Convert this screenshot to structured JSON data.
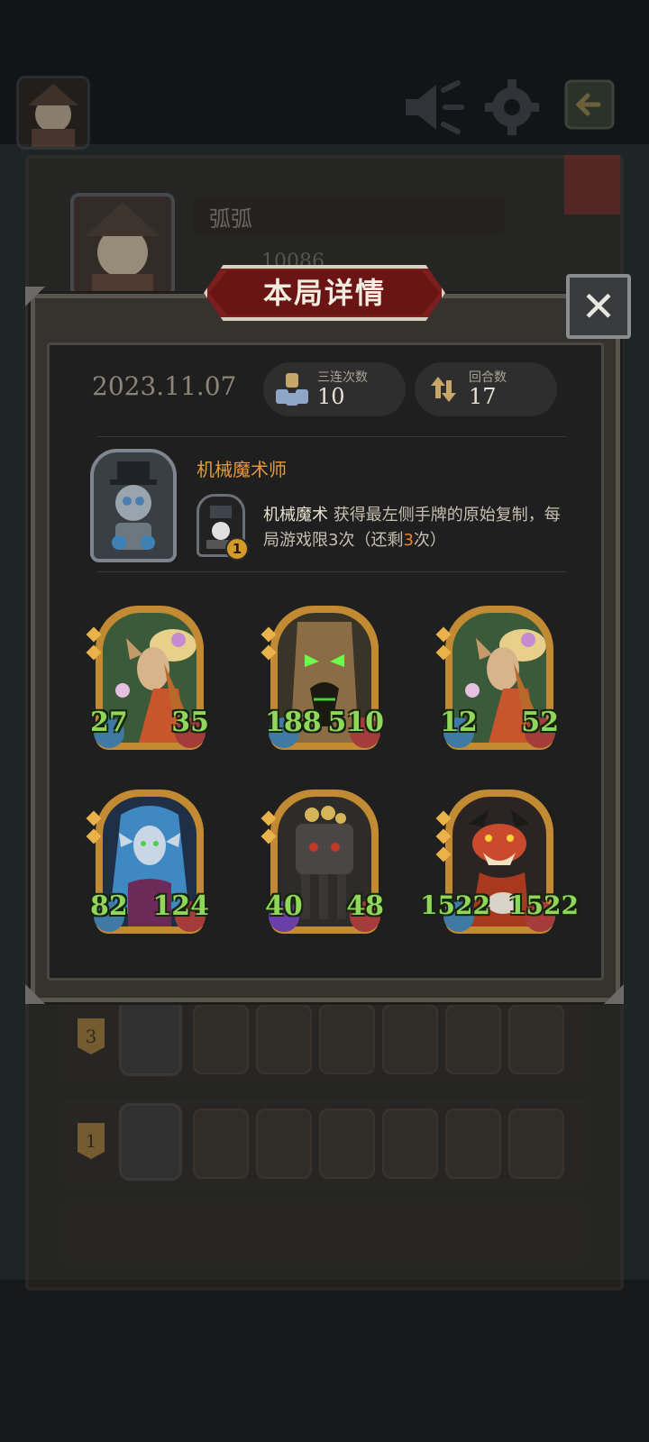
{
  "profile": {
    "name": "弧弧",
    "score": "10086"
  },
  "dialog": {
    "title": "本局详情",
    "close_symbol": "✕"
  },
  "summary": {
    "date": "2023.11.07",
    "triples_label": "三连次数",
    "triples_value": "10",
    "rounds_label": "回合数",
    "rounds_value": "17"
  },
  "hero": {
    "name": "机械魔术师",
    "skill_level": "1",
    "skill_name": "机械魔术",
    "skill_text_1": " 获得最左侧手牌的原始复制，每局游戏限3次（还剩",
    "skill_remaining": "3",
    "skill_text_2": "次）"
  },
  "cards": [
    {
      "name": "flower-elf-card",
      "atk": "27",
      "hp": "35"
    },
    {
      "name": "treant-card",
      "atk": "188",
      "hp": "510"
    },
    {
      "name": "flower-elf-card",
      "atk": "12",
      "hp": "52"
    },
    {
      "name": "siren-card",
      "atk": "82",
      "hp": "124"
    },
    {
      "name": "stone-golem-card",
      "atk": "40",
      "hp": "48"
    },
    {
      "name": "red-dragon-card",
      "atk": "1522",
      "hp": "1522"
    }
  ],
  "history": [
    {
      "rank": "3"
    },
    {
      "rank": "1"
    }
  ],
  "icons": {
    "top_left": "player-avatar-icon",
    "top_speaker": "speaker-icon",
    "top_settings": "gear-icon",
    "top_exit": "exit-icon",
    "triples": "triple-merge-icon",
    "rounds": "round-cycle-icon"
  },
  "colors": {
    "title_red": "#7a1e1e",
    "hero_name": "#e59a3b",
    "stat_green": "#8fd65a",
    "highlight_orange": "#e5862a"
  }
}
